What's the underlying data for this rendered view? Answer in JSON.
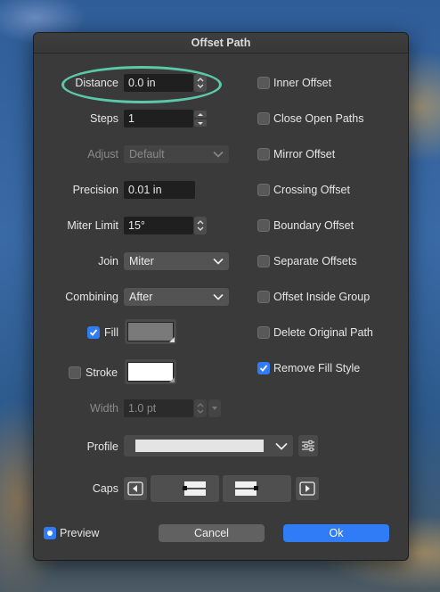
{
  "dialog": {
    "title": "Offset Path"
  },
  "left": {
    "distance": {
      "label": "Distance",
      "value": "0.0 in"
    },
    "steps": {
      "label": "Steps",
      "value": "1"
    },
    "adjust": {
      "label": "Adjust",
      "value": "Default"
    },
    "precision": {
      "label": "Precision",
      "value": "0.01 in"
    },
    "miter_limit": {
      "label": "Miter Limit",
      "value": "15°"
    },
    "join": {
      "label": "Join",
      "value": "Miter"
    },
    "combining": {
      "label": "Combining",
      "value": "After"
    },
    "fill": {
      "label": "Fill",
      "checked": true,
      "color": "#7a7a7a"
    },
    "stroke": {
      "label": "Stroke",
      "checked": false,
      "color": "#ffffff"
    },
    "width": {
      "label": "Width",
      "value": "1.0 pt"
    },
    "profile": {
      "label": "Profile"
    },
    "caps": {
      "label": "Caps"
    }
  },
  "right": {
    "options": [
      {
        "label": "Inner Offset",
        "checked": false
      },
      {
        "label": "Close Open Paths",
        "checked": false
      },
      {
        "label": "Mirror Offset",
        "checked": false
      },
      {
        "label": "Crossing Offset",
        "checked": false
      },
      {
        "label": "Boundary Offset",
        "checked": false
      },
      {
        "label": "Separate Offsets",
        "checked": false
      },
      {
        "label": "Offset Inside Group",
        "checked": false
      },
      {
        "label": "Delete Original Path",
        "checked": false
      },
      {
        "label": "Remove Fill Style",
        "checked": true
      }
    ]
  },
  "footer": {
    "preview_label": "Preview",
    "preview_on": true,
    "cancel_label": "Cancel",
    "ok_label": "Ok"
  },
  "colors": {
    "accent": "#2f7cf6",
    "highlight_ring": "#5bc9a8"
  }
}
